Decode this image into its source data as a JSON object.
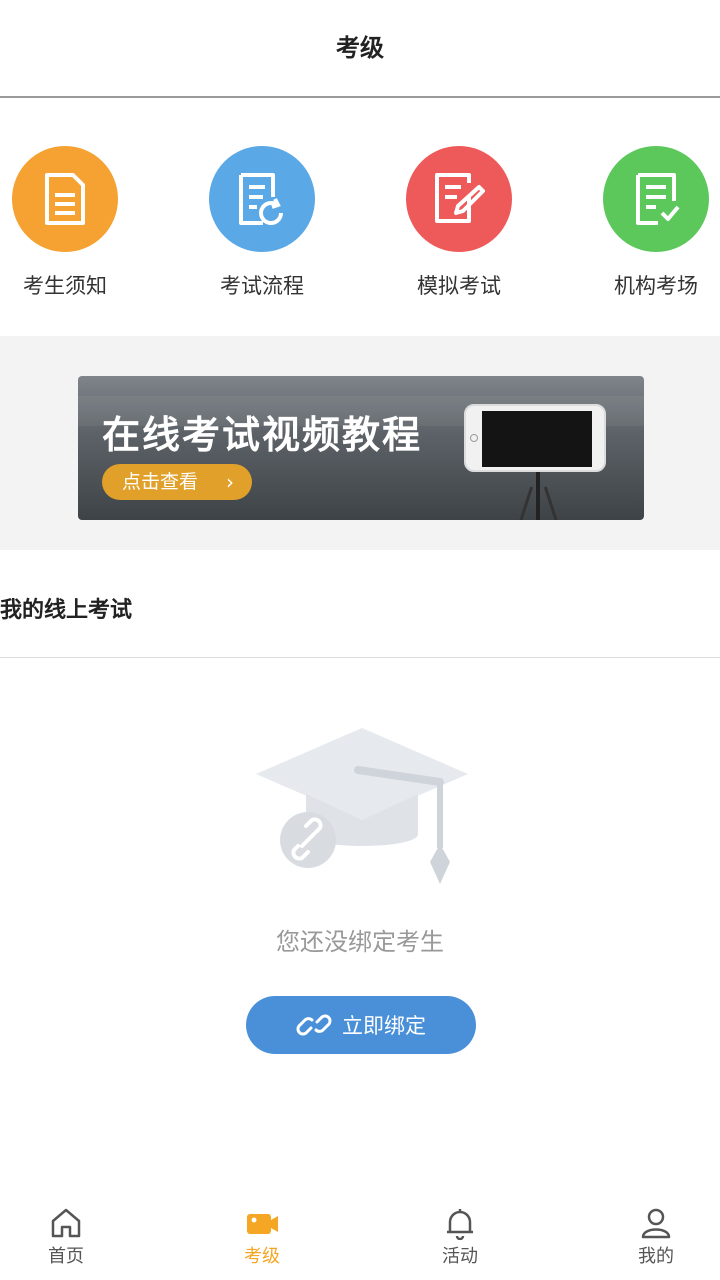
{
  "header": {
    "title": "考级"
  },
  "shortcuts": [
    {
      "label": "考生须知",
      "icon": "document-icon",
      "color": "#f5a232"
    },
    {
      "label": "考试流程",
      "icon": "document-refresh-icon",
      "color": "#5aa8e6"
    },
    {
      "label": "模拟考试",
      "icon": "document-edit-icon",
      "color": "#ee5a5a"
    },
    {
      "label": "机构考场",
      "icon": "document-check-icon",
      "color": "#5cc85c"
    }
  ],
  "banner": {
    "title": "在线考试视频教程",
    "button_label": "点击查看",
    "button_color": "#e0a02a"
  },
  "section": {
    "title": "我的线上考试"
  },
  "empty_state": {
    "text": "您还没绑定考生",
    "illustration": "graduation-cap-link-icon"
  },
  "bind_button": {
    "label": "立即绑定",
    "color": "#4a90d9",
    "icon": "link-icon"
  },
  "tabbar": {
    "accent": "#f5a623",
    "active": "考级",
    "items": [
      {
        "label": "首页",
        "icon": "home-icon"
      },
      {
        "label": "考级",
        "icon": "video-camera-icon"
      },
      {
        "label": "活动",
        "icon": "bell-icon"
      },
      {
        "label": "我的",
        "icon": "user-icon"
      }
    ]
  }
}
